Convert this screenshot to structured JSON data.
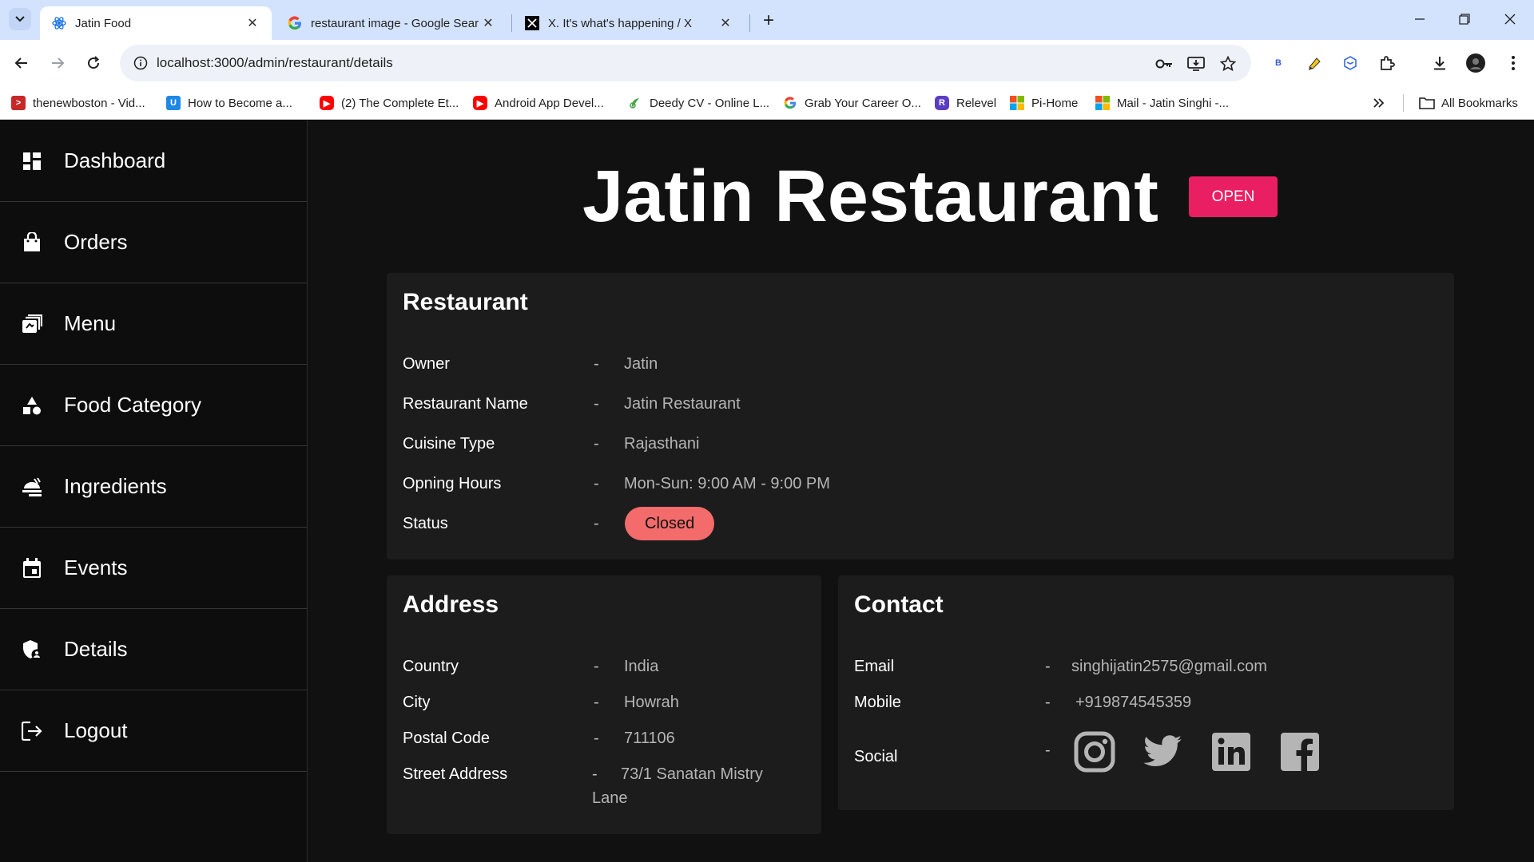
{
  "browser": {
    "tabs": [
      {
        "title": "Jatin Food",
        "active": true
      },
      {
        "title": "restaurant image - Google Sear",
        "active": false
      },
      {
        "title": "X. It's what's happening / X",
        "active": false
      }
    ],
    "url": "localhost:3000/admin/restaurant/details",
    "bookmarks": [
      {
        "label": "thenewboston - Vid...",
        "icon": "thenewboston-icon",
        "color": "#d32f2f"
      },
      {
        "label": "How to Become a...",
        "icon": "blue-u-icon",
        "color": "#1e88e5"
      },
      {
        "label": "(2) The Complete Et...",
        "icon": "youtube-icon",
        "color": "#ff0000"
      },
      {
        "label": "Android App Devel...",
        "icon": "youtube-icon",
        "color": "#ff0000"
      },
      {
        "label": "Deedy CV - Online L...",
        "icon": "overleaf-icon",
        "color": "#4caf50"
      },
      {
        "label": "Grab Your Career O...",
        "icon": "google-icon",
        "color": "#4285f4"
      },
      {
        "label": "Relevel",
        "icon": "relevel-icon",
        "color": "#5b3cc4"
      },
      {
        "label": "Pi-Home",
        "icon": "microsoft-icon",
        "color": "#f25022"
      },
      {
        "label": "Mail - Jatin Singhi -...",
        "icon": "microsoft-icon",
        "color": "#f25022"
      }
    ],
    "all_bookmarks": "All Bookmarks"
  },
  "sidebar": {
    "items": [
      {
        "label": "Dashboard",
        "icon": "dashboard-icon"
      },
      {
        "label": "Orders",
        "icon": "shopping-bag-icon"
      },
      {
        "label": "Menu",
        "icon": "menu-book-icon"
      },
      {
        "label": "Food Category",
        "icon": "category-icon"
      },
      {
        "label": "Ingredients",
        "icon": "ingredients-icon"
      },
      {
        "label": "Events",
        "icon": "calendar-icon"
      },
      {
        "label": "Details",
        "icon": "admin-shield-icon"
      },
      {
        "label": "Logout",
        "icon": "logout-icon"
      }
    ]
  },
  "page": {
    "title": "Jatin Restaurant",
    "open_button": "OPEN",
    "accent_color": "#e91e63"
  },
  "restaurant": {
    "title": "Restaurant",
    "rows": [
      {
        "label": "Owner",
        "value": "Jatin"
      },
      {
        "label": "Restaurant Name",
        "value": "Jatin Restaurant"
      },
      {
        "label": "Cuisine Type",
        "value": "Rajasthani"
      },
      {
        "label": "Opning Hours",
        "value": "Mon-Sun: 9:00 AM - 9:00 PM"
      },
      {
        "label": "Status",
        "value": "Closed"
      }
    ],
    "status_color": "#f36b6b"
  },
  "address": {
    "title": "Address",
    "rows": [
      {
        "label": "Country",
        "value": "India"
      },
      {
        "label": "City",
        "value": "Howrah"
      },
      {
        "label": "Postal Code",
        "value": "711106"
      },
      {
        "label": "Street Address",
        "value": "73/1 Sanatan Mistry Lane"
      }
    ]
  },
  "contact": {
    "title": "Contact",
    "rows": [
      {
        "label": "Email",
        "value": "singhijatin2575@gmail.com"
      },
      {
        "label": "Mobile",
        "value": "+919874545359"
      },
      {
        "label": "Social",
        "value": ""
      }
    ],
    "social": [
      "instagram-icon",
      "twitter-icon",
      "linkedin-icon",
      "facebook-icon"
    ]
  },
  "dash": "-"
}
